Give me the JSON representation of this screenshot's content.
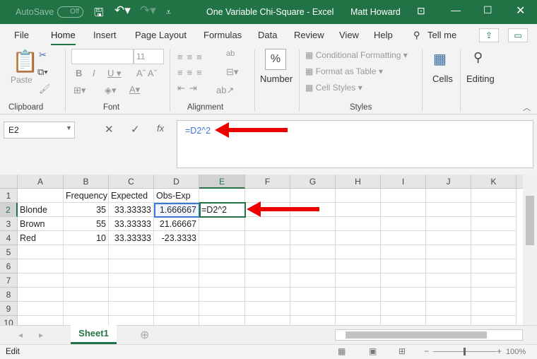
{
  "titlebar": {
    "autosave": "AutoSave",
    "autosave_state": "Off",
    "title": "One Variable Chi-Square  -  Excel",
    "user": "Matt Howard"
  },
  "tabs": [
    "File",
    "Home",
    "Insert",
    "Page Layout",
    "Formulas",
    "Data",
    "Review",
    "View",
    "Help",
    "Tell me"
  ],
  "ribbon": {
    "paste": "Paste",
    "font_size": "11",
    "clipboard": "Clipboard",
    "font": "Font",
    "alignment": "Alignment",
    "number": "Number",
    "conditional_formatting": "Conditional Formatting",
    "format_as_table": "Format as Table",
    "cell_styles": "Cell Styles",
    "styles": "Styles",
    "cells": "Cells",
    "editing": "Editing"
  },
  "formula_bar": {
    "name_box": "E2",
    "formula": "=D2^2"
  },
  "columns": [
    "A",
    "B",
    "C",
    "D",
    "E",
    "F",
    "G",
    "H",
    "I",
    "J",
    "K"
  ],
  "rows": [
    "1",
    "2",
    "3",
    "4",
    "5",
    "6",
    "7",
    "8",
    "9",
    "10"
  ],
  "cells": {
    "B1": "Frequency",
    "C1": "Expected",
    "D1": "Obs-Exp",
    "A2": "Blonde",
    "B2": "35",
    "C2": "33.33333",
    "D2": "1.666667",
    "E2": "=D2^2",
    "A3": "Brown",
    "B3": "55",
    "C3": "33.33333",
    "D3": "21.66667",
    "A4": "Red",
    "B4": "10",
    "C4": "33.33333",
    "D4": "-23.3333"
  },
  "sheets": [
    "Sheet1"
  ],
  "status": {
    "mode": "Edit",
    "zoom": "100%"
  },
  "colors": {
    "accent": "#217346",
    "arrow": "#e00000",
    "ref": "#3c78d8"
  }
}
